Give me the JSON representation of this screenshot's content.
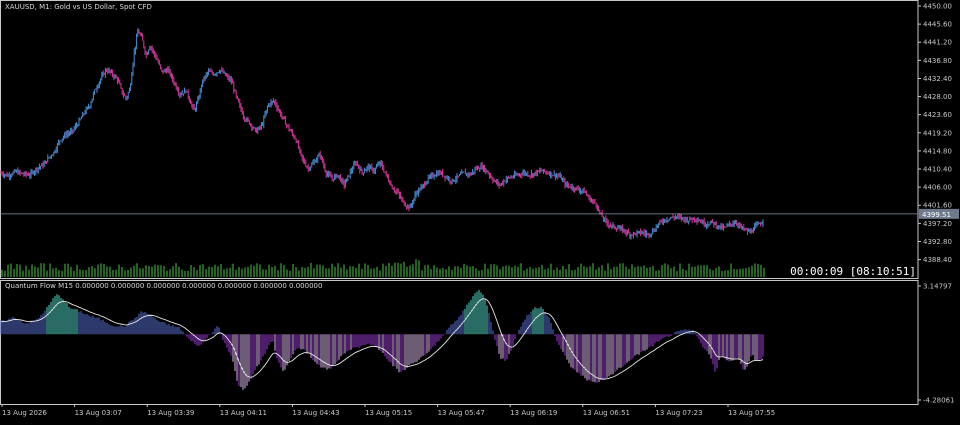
{
  "chart_data": {
    "type": "candlestick",
    "title": "XAUUSD, M1:  Gold vs US Dollar, Spot CFD",
    "timer": "00:00:09 [08:10:51]",
    "current_price_label": "4399.51",
    "current_price": 4399.51,
    "price_axis": {
      "ticks": [
        "4450.00",
        "4445.60",
        "4441.20",
        "4436.80",
        "4432.40",
        "4428.00",
        "4423.60",
        "4419.20",
        "4414.80",
        "4410.40",
        "4406.00",
        "4401.60",
        "4397.20",
        "4392.80",
        "4388.40"
      ],
      "min": 4386.6,
      "max": 4450.0
    },
    "time_axis": {
      "ticks": [
        "13 Aug 2026",
        "13 Aug 03:07",
        "13 Aug 03:39",
        "13 Aug 04:11",
        "13 Aug 04:43",
        "13 Aug 05:15",
        "13 Aug 05:47",
        "13 Aug 06:19",
        "13 Aug 06:51",
        "13 Aug 07:23",
        "13 Aug 07:55"
      ]
    },
    "colors": {
      "background": "#000000",
      "bull": "#4a8fd6",
      "bear": "#d6389c",
      "volume": "#3fa33a",
      "axis": "#c8c8c8",
      "price_line": "#8896a8"
    },
    "close_path": [
      [
        0,
        4409.5
      ],
      [
        8,
        4408.8
      ],
      [
        16,
        4409.8
      ],
      [
        22,
        4409.2
      ],
      [
        30,
        4409.0
      ],
      [
        38,
        4410.8
      ],
      [
        44,
        4411.5
      ],
      [
        48,
        4413.0
      ],
      [
        54,
        4414.5
      ],
      [
        60,
        4417.5
      ],
      [
        66,
        4418.8
      ],
      [
        72,
        4419.5
      ],
      [
        78,
        4421.5
      ],
      [
        84,
        4424.0
      ],
      [
        90,
        4426.0
      ],
      [
        94,
        4429.0
      ],
      [
        100,
        4432.0
      ],
      [
        106,
        4434.5
      ],
      [
        110,
        4434.0
      ],
      [
        114,
        4433.0
      ],
      [
        118,
        4432.0
      ],
      [
        122,
        4429.0
      ],
      [
        126,
        4427.5
      ],
      [
        130,
        4430.0
      ],
      [
        134,
        4438.5
      ],
      [
        138,
        4444.0
      ],
      [
        142,
        4442.0
      ],
      [
        146,
        4438.0
      ],
      [
        150,
        4440.5
      ],
      [
        156,
        4437.5
      ],
      [
        162,
        4434.0
      ],
      [
        168,
        4434.5
      ],
      [
        174,
        4431.5
      ],
      [
        180,
        4428.5
      ],
      [
        186,
        4429.5
      ],
      [
        190,
        4427.0
      ],
      [
        194,
        4424.5
      ],
      [
        198,
        4427.0
      ],
      [
        202,
        4431.5
      ],
      [
        208,
        4434.0
      ],
      [
        214,
        4433.5
      ],
      [
        220,
        4434.5
      ],
      [
        226,
        4433.0
      ],
      [
        232,
        4431.5
      ],
      [
        236,
        4428.0
      ],
      [
        240,
        4425.5
      ],
      [
        244,
        4423.0
      ],
      [
        250,
        4421.5
      ],
      [
        256,
        4419.5
      ],
      [
        262,
        4421.0
      ],
      [
        268,
        4426.0
      ],
      [
        274,
        4427.0
      ],
      [
        280,
        4424.0
      ],
      [
        288,
        4420.5
      ],
      [
        296,
        4417.5
      ],
      [
        302,
        4413.0
      ],
      [
        308,
        4410.5
      ],
      [
        314,
        4412.0
      ],
      [
        320,
        4414.0
      ],
      [
        326,
        4409.5
      ],
      [
        332,
        4408.0
      ],
      [
        338,
        4409.0
      ],
      [
        344,
        4406.5
      ],
      [
        350,
        4409.5
      ],
      [
        356,
        4412.0
      ],
      [
        362,
        4409.5
      ],
      [
        368,
        4411.0
      ],
      [
        374,
        4410.0
      ],
      [
        380,
        4412.0
      ],
      [
        386,
        4409.0
      ],
      [
        392,
        4406.0
      ],
      [
        398,
        4404.5
      ],
      [
        404,
        4402.0
      ],
      [
        410,
        4401.0
      ],
      [
        416,
        4404.5
      ],
      [
        422,
        4406.0
      ],
      [
        428,
        4408.0
      ],
      [
        434,
        4409.0
      ],
      [
        440,
        4409.5
      ],
      [
        446,
        4408.5
      ],
      [
        452,
        4407.5
      ],
      [
        458,
        4408.5
      ],
      [
        464,
        4409.5
      ],
      [
        470,
        4409.0
      ],
      [
        476,
        4410.5
      ],
      [
        482,
        4411.0
      ],
      [
        488,
        4409.5
      ],
      [
        494,
        4407.5
      ],
      [
        500,
        4406.5
      ],
      [
        506,
        4408.0
      ],
      [
        512,
        4408.5
      ],
      [
        518,
        4409.0
      ],
      [
        524,
        4409.5
      ],
      [
        530,
        4409.0
      ],
      [
        536,
        4409.5
      ],
      [
        542,
        4410.0
      ],
      [
        548,
        4409.5
      ],
      [
        554,
        4409.0
      ],
      [
        560,
        4408.5
      ],
      [
        566,
        4406.5
      ],
      [
        572,
        4406.0
      ],
      [
        578,
        4405.5
      ],
      [
        584,
        4405.0
      ],
      [
        590,
        4403.0
      ],
      [
        596,
        4402.0
      ],
      [
        600,
        4399.5
      ],
      [
        606,
        4397.5
      ],
      [
        612,
        4396.5
      ],
      [
        618,
        4396.0
      ],
      [
        624,
        4395.5
      ],
      [
        630,
        4394.5
      ],
      [
        636,
        4394.8
      ],
      [
        642,
        4395.0
      ],
      [
        648,
        4394.5
      ],
      [
        654,
        4395.5
      ],
      [
        658,
        4397.0
      ],
      [
        664,
        4398.0
      ],
      [
        670,
        4398.5
      ],
      [
        676,
        4398.8
      ],
      [
        682,
        4398.5
      ],
      [
        688,
        4398.0
      ],
      [
        694,
        4398.5
      ],
      [
        700,
        4397.8
      ],
      [
        706,
        4397.0
      ],
      [
        712,
        4397.5
      ],
      [
        718,
        4396.5
      ],
      [
        724,
        4396.0
      ],
      [
        730,
        4397.0
      ],
      [
        736,
        4397.5
      ],
      [
        742,
        4396.0
      ],
      [
        746,
        4395.5
      ],
      [
        750,
        4395.0
      ],
      [
        756,
        4396.5
      ],
      [
        762,
        4397.5
      ],
      [
        764,
        4398.0
      ]
    ],
    "indicator": {
      "title": "Quantum Flow M15 0.000000 0.000000 0.000000 0.000000 0.000000 0.000000 0.000000",
      "ticks": [
        "3.14797",
        "-4.28061"
      ],
      "min": -4.28061,
      "max": 3.14797,
      "colors": {
        "pos_bright": "#4fd9c8",
        "pos": "#5a6fd6",
        "neg": "#9b3cd6",
        "neg_soft": "#d8b8e8",
        "signal": "#e8e8e8"
      },
      "hist_path": [
        [
          0,
          0.8
        ],
        [
          14,
          1.1
        ],
        [
          26,
          0.7
        ],
        [
          38,
          1.0
        ],
        [
          48,
          1.8
        ],
        [
          56,
          2.6
        ],
        [
          62,
          2.4
        ],
        [
          70,
          1.7
        ],
        [
          80,
          1.5
        ],
        [
          90,
          1.2
        ],
        [
          100,
          1.0
        ],
        [
          112,
          0.6
        ],
        [
          124,
          0.5
        ],
        [
          134,
          1.0
        ],
        [
          142,
          1.5
        ],
        [
          150,
          1.3
        ],
        [
          160,
          0.8
        ],
        [
          170,
          0.6
        ],
        [
          180,
          0.4
        ],
        [
          190,
          -0.4
        ],
        [
          200,
          -0.8
        ],
        [
          210,
          0.0
        ],
        [
          218,
          0.6
        ],
        [
          224,
          -0.5
        ],
        [
          232,
          -1.5
        ],
        [
          238,
          -3.3
        ],
        [
          244,
          -3.7
        ],
        [
          250,
          -3.0
        ],
        [
          258,
          -2.0
        ],
        [
          266,
          -1.2
        ],
        [
          272,
          -0.3
        ],
        [
          278,
          -1.8
        ],
        [
          284,
          -2.5
        ],
        [
          290,
          -1.6
        ],
        [
          298,
          -0.8
        ],
        [
          306,
          -1.1
        ],
        [
          314,
          -1.7
        ],
        [
          322,
          -2.2
        ],
        [
          330,
          -2.3
        ],
        [
          340,
          -1.5
        ],
        [
          350,
          -1.0
        ],
        [
          360,
          -0.8
        ],
        [
          370,
          -0.6
        ],
        [
          380,
          -1.0
        ],
        [
          390,
          -1.8
        ],
        [
          400,
          -2.5
        ],
        [
          410,
          -2.0
        ],
        [
          420,
          -1.6
        ],
        [
          430,
          -1.1
        ],
        [
          440,
          -0.3
        ],
        [
          450,
          0.5
        ],
        [
          458,
          1.0
        ],
        [
          466,
          1.8
        ],
        [
          474,
          2.6
        ],
        [
          480,
          2.9
        ],
        [
          486,
          2.2
        ],
        [
          492,
          0.6
        ],
        [
          496,
          -0.6
        ],
        [
          500,
          -1.5
        ],
        [
          506,
          -1.7
        ],
        [
          512,
          -0.9
        ],
        [
          518,
          0.2
        ],
        [
          526,
          1.1
        ],
        [
          534,
          1.7
        ],
        [
          542,
          1.8
        ],
        [
          550,
          1.0
        ],
        [
          556,
          -0.4
        ],
        [
          564,
          -1.3
        ],
        [
          572,
          -2.2
        ],
        [
          580,
          -2.6
        ],
        [
          588,
          -3.0
        ],
        [
          596,
          -3.2
        ],
        [
          606,
          -2.9
        ],
        [
          616,
          -2.4
        ],
        [
          626,
          -1.9
        ],
        [
          636,
          -1.4
        ],
        [
          646,
          -1.0
        ],
        [
          656,
          -0.6
        ],
        [
          666,
          -0.2
        ],
        [
          676,
          0.1
        ],
        [
          686,
          0.3
        ],
        [
          694,
          0.2
        ],
        [
          702,
          -0.7
        ],
        [
          710,
          -1.4
        ],
        [
          716,
          -2.6
        ],
        [
          720,
          -1.3
        ],
        [
          726,
          -1.6
        ],
        [
          732,
          -1.8
        ],
        [
          738,
          -1.5
        ],
        [
          744,
          -2.4
        ],
        [
          748,
          -2.0
        ],
        [
          752,
          -1.2
        ],
        [
          756,
          -1.8
        ],
        [
          762,
          -1.6
        ],
        [
          764,
          -1.4
        ]
      ]
    }
  }
}
